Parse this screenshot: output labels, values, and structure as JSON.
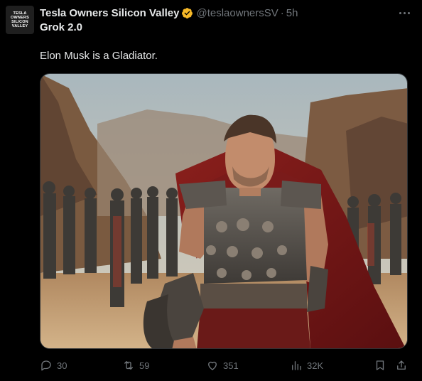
{
  "tweet": {
    "avatar": {
      "lines": [
        "TESLA",
        "OWNERS",
        "SILICON",
        "VALLEY"
      ]
    },
    "display_name": "Tesla Owners Silicon Valley",
    "verified_icon": "verified-badge-icon",
    "handle": "@teslaownersSV",
    "separator": "·",
    "time": "5h",
    "text_line1": "Grok 2.0",
    "text_line2": "Elon Musk is a Gladiator.",
    "media_description_icon": "gladiator-image",
    "colors": {
      "background": "#000000",
      "text": "#e7e9ea",
      "muted": "#71767b",
      "verified": "#f7b928"
    }
  },
  "actions": {
    "reply": {
      "icon": "reply-icon",
      "count": "30"
    },
    "retweet": {
      "icon": "retweet-icon",
      "count": "59"
    },
    "like": {
      "icon": "heart-icon",
      "count": "351"
    },
    "views": {
      "icon": "views-icon",
      "count": "32K"
    },
    "bookmark": {
      "icon": "bookmark-icon"
    },
    "share": {
      "icon": "share-icon"
    }
  }
}
